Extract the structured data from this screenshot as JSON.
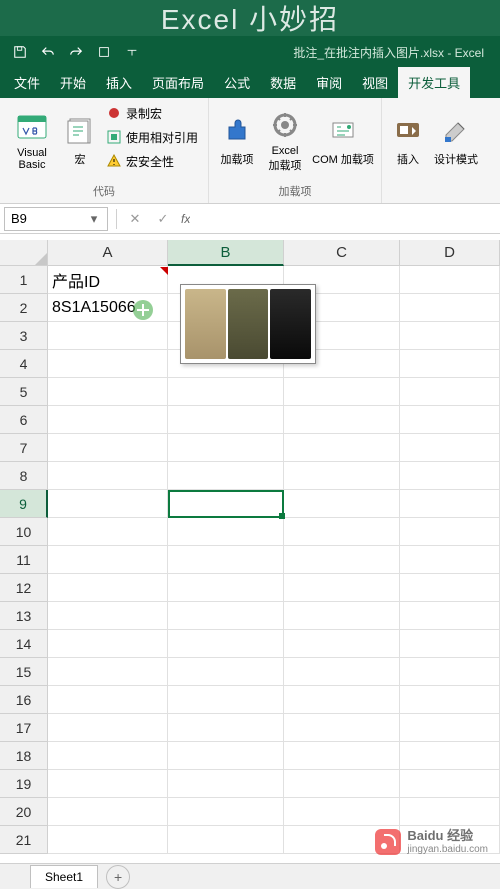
{
  "banner": "Excel 小妙招",
  "titlebar": {
    "doc_title": "批注_在批注内插入图片.xlsx - Excel"
  },
  "tabs": {
    "file": "文件",
    "home": "开始",
    "insert": "插入",
    "layout": "页面布局",
    "formulas": "公式",
    "data": "数据",
    "review": "审阅",
    "view": "视图",
    "developer": "开发工具"
  },
  "ribbon": {
    "code": {
      "vb": "Visual Basic",
      "macros": "宏",
      "record": "录制宏",
      "relative": "使用相对引用",
      "security": "宏安全性",
      "group_label": "代码"
    },
    "addins": {
      "addins": "加载项",
      "excel_addins": "Excel\n加载项",
      "com_addins": "COM 加载项",
      "group_label": "加载项"
    },
    "controls": {
      "insert": "插入",
      "design": "设计模式"
    }
  },
  "namebox": "B9",
  "fx": "fx",
  "columns": [
    "A",
    "B",
    "C",
    "D"
  ],
  "rows": [
    "1",
    "2",
    "3",
    "4",
    "5",
    "6",
    "7",
    "8",
    "9",
    "10",
    "11",
    "12",
    "13",
    "14",
    "15",
    "16",
    "17",
    "18",
    "19",
    "20",
    "21"
  ],
  "cells": {
    "A1": "产品ID",
    "A2": "8S1A15066"
  },
  "active_cell": {
    "row": 9,
    "col": "B"
  },
  "sheet": {
    "name": "Sheet1"
  },
  "watermark": {
    "brand": "Baidu 经验",
    "url": "jingyan.baidu.com"
  }
}
